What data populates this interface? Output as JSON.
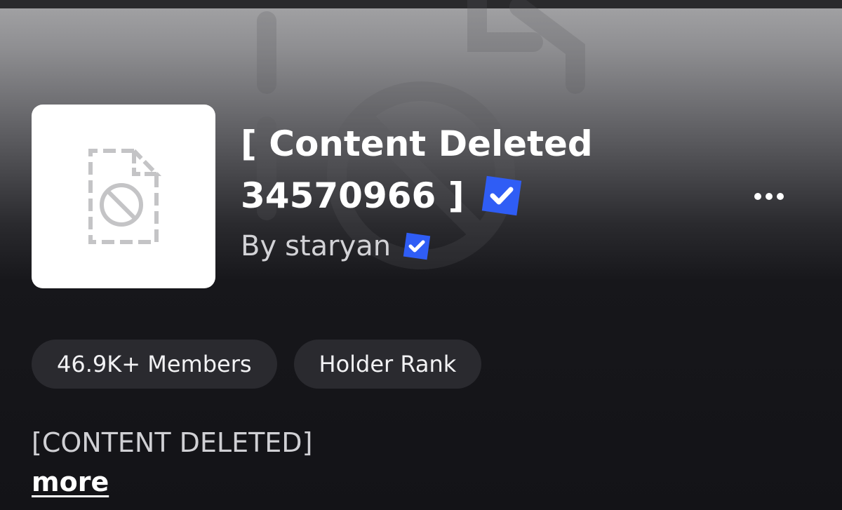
{
  "item": {
    "title_line1": "[ Content Deleted",
    "title_line2": "34570966 ]",
    "by_prefix": "By",
    "creator": "staryan",
    "description": "[CONTENT DELETED]",
    "more_link": "more"
  },
  "pills": [
    {
      "label": "46.9K+ Members"
    },
    {
      "label": "Holder Rank"
    }
  ],
  "icons": {
    "thumbnail": "deleted-content-icon",
    "verified": "verified-badge-icon",
    "menu": "ellipsis-icon"
  },
  "colors": {
    "verified": "#2f5df5",
    "pill_bg": "#2a2a2f",
    "page_bg": "#131317"
  }
}
